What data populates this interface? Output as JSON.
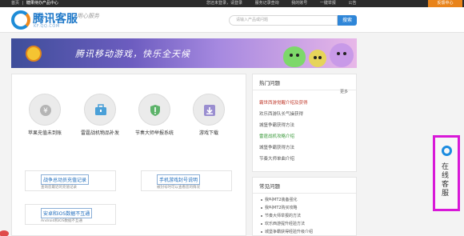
{
  "topbar": {
    "home": "首页",
    "crumb": "糖果待办产品中心",
    "links": [
      "您还未登录，请登录",
      "服务记录查询",
      "我的账号",
      "一键举报",
      "公告"
    ],
    "feedback": "反馈中心"
  },
  "header": {
    "logo_title": "腾讯客服",
    "logo_domain": "KF.QQ.COM",
    "slogan": "用心服务",
    "search_placeholder": "请输入产品或问题",
    "search_button": "搜索"
  },
  "banner": {
    "text": "腾讯移动游戏，快乐全天候"
  },
  "services": [
    {
      "label": "苹果充值未到账",
      "icon": "coin-icon"
    },
    {
      "label": "雷霆战机物品补发",
      "icon": "toolbox-icon"
    },
    {
      "label": "节奏大师举报系统",
      "icon": "shield-icon"
    },
    {
      "label": "游戏下载",
      "icon": "download-icon"
    }
  ],
  "cards": [
    {
      "title": "战争总动员充值记录",
      "desc": "查询您最近的充值记录"
    },
    {
      "title": "手机游戏封号说明",
      "desc": "被封号时可以查看您的情况"
    },
    {
      "title": "安卓和iOS数据不互通",
      "desc": "Android和iOS数据不互通"
    }
  ],
  "hot": {
    "title": "热门问题",
    "more": "更多",
    "items": [
      {
        "text": "霸世西游觉醒介绍及获得",
        "style": "red"
      },
      {
        "text": "欢乐西游队长气操获得",
        "style": ""
      },
      {
        "text": "城堡争霸获得方法",
        "style": ""
      },
      {
        "text": "雷霆战机攻略介绍",
        "style": "green"
      },
      {
        "text": "城堡争霸获得方法",
        "style": ""
      },
      {
        "text": "节奏大师单曲介绍",
        "style": ""
      }
    ]
  },
  "common": {
    "title": "常见问题",
    "items": [
      "我叫MT2装备强化",
      "我叫MT2购买攻略",
      "节奏大师举报的方法",
      "欢乐西游提升经验方法",
      "城堡争霸获得经验升级介绍"
    ]
  },
  "float_service": {
    "label": "在线客服"
  },
  "colors": {
    "accent": "#2f86d8",
    "feedback": "#e8831a",
    "highlight": "#d818d8"
  }
}
